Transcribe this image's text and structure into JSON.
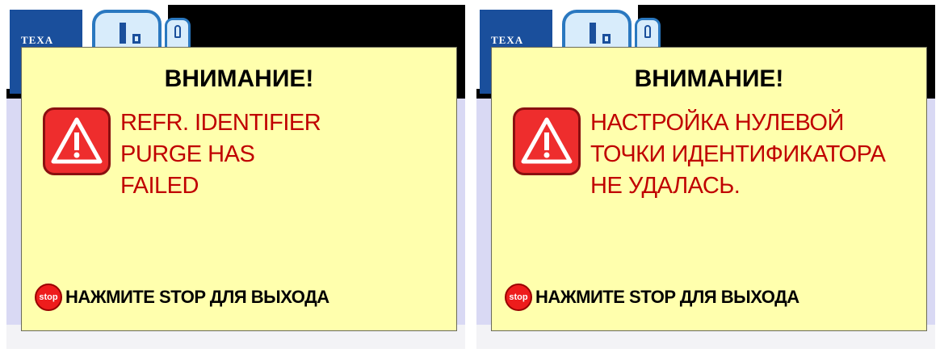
{
  "screens": [
    {
      "logo_text": "TEXA",
      "dialog": {
        "title": "ВНИМАНИЕ!",
        "message_lines": [
          "REFR. IDENTIFIER",
          "PURGE HAS",
          "FAILED"
        ],
        "stop_icon_text": "stop",
        "footer": "НАЖМИТЕ STOP ДЛЯ ВЫХОДА"
      }
    },
    {
      "logo_text": "TEXA",
      "dialog": {
        "title": "ВНИМАНИЕ!",
        "message_lines": [
          "НАСТРОЙКА НУЛЕВОЙ",
          "ТОЧКИ ИДЕНТИФИКАТОРА",
          "НЕ УДАЛАСЬ."
        ],
        "stop_icon_text": "stop",
        "footer": "НАЖМИТЕ STOP ДЛЯ ВЫХОДА"
      }
    }
  ],
  "colors": {
    "dialog_bg": "#ffffad",
    "message_text": "#c00000",
    "warning_red": "#ee2d2d",
    "logo_blue": "#1a4f9c"
  },
  "icons": {
    "warning": "warning-triangle-icon",
    "stop": "stop-icon"
  }
}
